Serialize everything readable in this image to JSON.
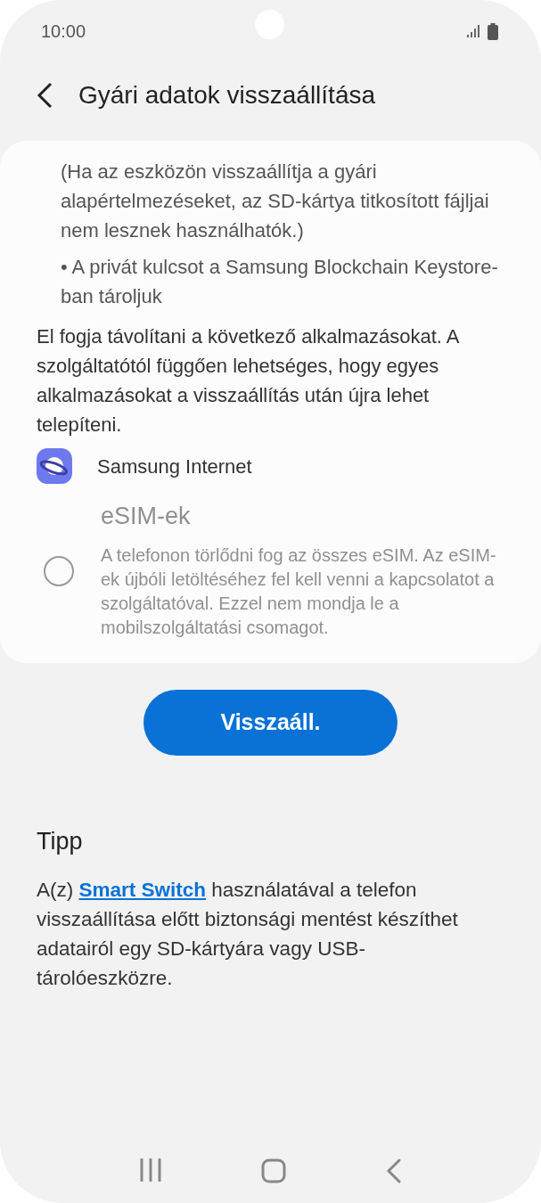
{
  "status_bar": {
    "time": "10:00"
  },
  "header": {
    "title": "Gyári adatok visszaállítása"
  },
  "card": {
    "notes": [
      "(Ha az eszközön visszaállítja a gyári alapértelmezéseket, az SD-kártya titkosított fájljai nem lesznek használhatók.)",
      "• A privát kulcsot a Samsung Blockchain Keystore-ban tároljuk"
    ],
    "apps_intro": "El fogja távolítani a következő alkalmazásokat. A szolgáltatótól függően lehetséges, hogy egyes alkalmazásokat a visszaállítás után újra lehet telepíteni.",
    "apps": [
      {
        "name": "Samsung Internet"
      }
    ],
    "option": {
      "title": "eSIM-ek",
      "description": "A telefonon törlődni fog az összes eSIM. Az eSIM-ek újbóli letöltéséhez fel kell venni a kapcsolatot a szolgáltatóval. Ezzel nem mondja le a mobilszolgáltatási csomagot.",
      "checked": false,
      "disabled": true
    }
  },
  "button": {
    "label": "Visszaáll."
  },
  "tip": {
    "title": "Tipp",
    "prefix": "A(z) ",
    "link": "Smart Switch",
    "suffix": " használatával a telefon visszaállítása előtt biztonsági mentést készíthet adatairól egy SD-kártyára vagy USB-tárolóeszközre."
  }
}
